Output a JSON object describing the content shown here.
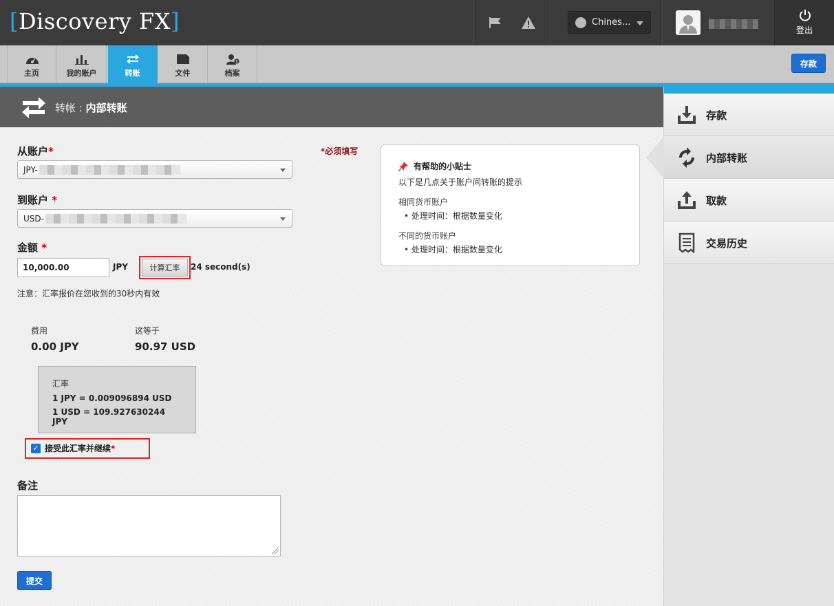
{
  "header": {
    "logo_bracket_open": "[",
    "logo_text": "Discovery FX",
    "logo_bracket_close": "]",
    "language": "Chines...",
    "logout_label": "登出",
    "icons": [
      "flag-icon",
      "warning-icon",
      "globe-icon",
      "user-avatar-icon",
      "power-icon"
    ]
  },
  "nav": {
    "items": [
      {
        "label": "主页",
        "icon": "dashboard-icon"
      },
      {
        "label": "我的账户",
        "icon": "bar-chart-icon"
      },
      {
        "label": "转账",
        "icon": "transfer-icon"
      },
      {
        "label": "文件",
        "icon": "folder-icon"
      },
      {
        "label": "档案",
        "icon": "profile-icon"
      }
    ],
    "deposit_label": "存款"
  },
  "page": {
    "title_prefix": "转帐 : ",
    "title_main": "内部转账"
  },
  "form": {
    "from_label": "从账户",
    "from_value": "JPY-",
    "to_label": "到账户 ",
    "to_value": "USD-",
    "required_mark": "*",
    "required_note": "*必须填写",
    "amount_label": "金额 ",
    "amount_value": "10,000.00",
    "amount_currency": "JPY",
    "calc_button": "计算汇率",
    "countdown": "24 second(s)",
    "notice": "注意：汇率报价在您收到的30秒内有效",
    "fee_label": "费用",
    "fee_value": "0.00 JPY",
    "equals_label": "这等于",
    "equals_value": "90.97 USD",
    "rate_title": "汇率",
    "rate_line1": "1 JPY = 0.009096894 USD",
    "rate_line2": "1 USD = 109.927630244 JPY",
    "accept_label": "接受此汇率并继续 ",
    "notes_label": "备注",
    "submit_label": "提交"
  },
  "tips": {
    "title": "有帮助的小贴士",
    "intro": "以下是几点关于账户间转账的提示",
    "same_title": "相同货币账户",
    "same_item": "处理时间：根据数量变化",
    "diff_title": "不同的货币账户",
    "diff_item": "处理时间：根据数量变化"
  },
  "sidebar": {
    "items": [
      {
        "label": "存款",
        "icon": "deposit-icon"
      },
      {
        "label": "内部转账",
        "icon": "internal-transfer-icon"
      },
      {
        "label": "取款",
        "icon": "withdraw-icon"
      },
      {
        "label": "交易历史",
        "icon": "receipt-icon"
      }
    ]
  },
  "colors": {
    "accent": "#2aa7df",
    "button_blue": "#1e6fd0",
    "topbar": "#3b3b3b",
    "required_red": "#cc0000"
  }
}
